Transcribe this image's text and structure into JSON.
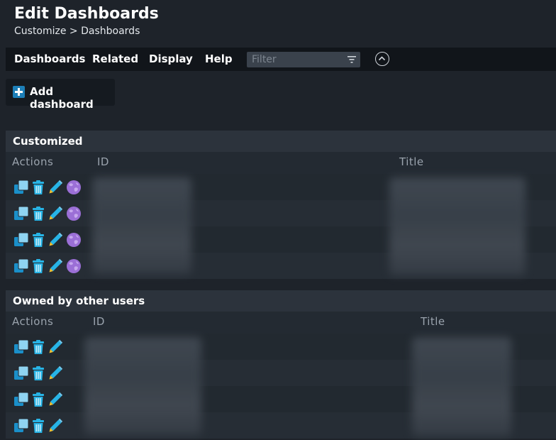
{
  "header": {
    "title": "Edit Dashboards",
    "breadcrumb": "Customize > Dashboards"
  },
  "menu": {
    "items": [
      "Dashboards",
      "Related",
      "Display",
      "Help"
    ],
    "filter_placeholder": "Filter"
  },
  "toolbar": {
    "add_label": "Add dashboard"
  },
  "sections": [
    {
      "title": "Customized",
      "columns": [
        "Actions",
        "ID",
        "Title"
      ],
      "row_count": 4,
      "actions": [
        "clone",
        "delete",
        "edit",
        "publish"
      ]
    },
    {
      "title": "Owned by other users",
      "columns": [
        "Actions",
        "ID",
        "Title"
      ],
      "row_count": 4,
      "actions": [
        "clone",
        "delete",
        "edit"
      ]
    }
  ],
  "colors": {
    "background": "#1e232a",
    "menubar": "#11151a",
    "accent": "#1d7fb8",
    "section_header": "#2c333c",
    "column_header": "#232a32",
    "icon_cyan": "#27b4e6",
    "icon_purple": "#9b6fd6",
    "pencil_yellow": "#f0c030"
  },
  "icons": {
    "clone": "clone-icon",
    "delete": "trash-icon",
    "edit": "pencil-icon",
    "publish": "globe-icon",
    "filter": "filter-icon",
    "collapse": "chevron-up-icon",
    "add": "plus-icon"
  }
}
